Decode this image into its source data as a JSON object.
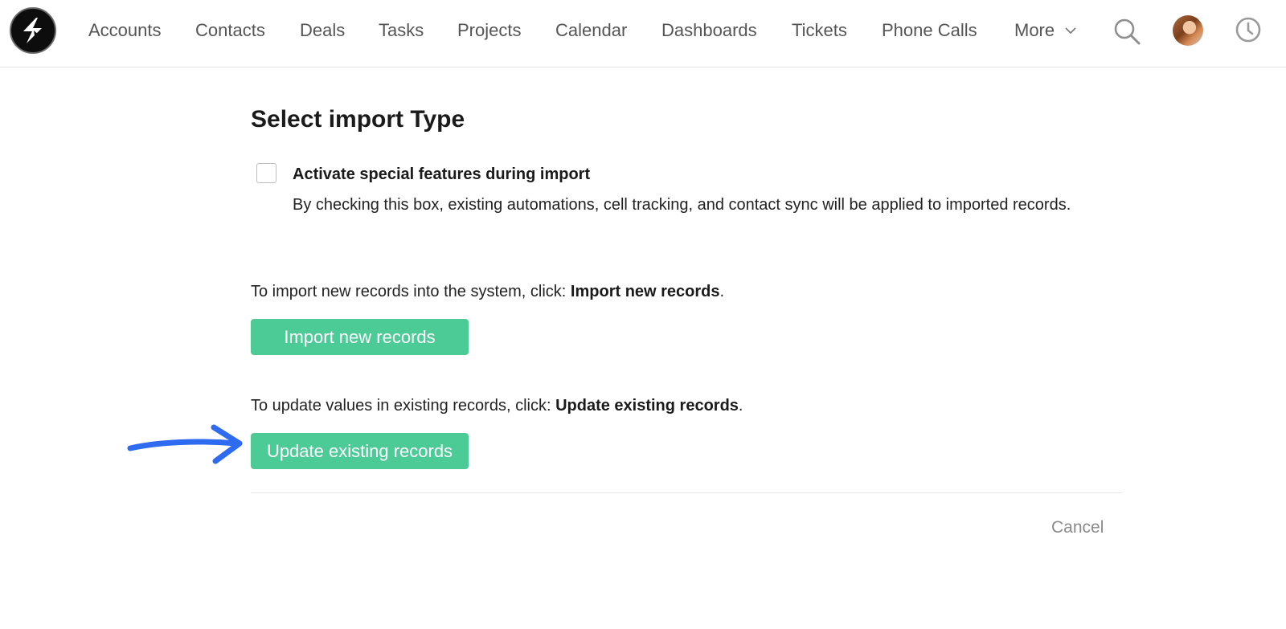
{
  "nav": {
    "items": [
      {
        "label": "Accounts"
      },
      {
        "label": "Contacts"
      },
      {
        "label": "Deals"
      },
      {
        "label": "Tasks"
      },
      {
        "label": "Projects"
      },
      {
        "label": "Calendar"
      },
      {
        "label": "Dashboards"
      },
      {
        "label": "Tickets"
      },
      {
        "label": "Phone Calls"
      }
    ],
    "more_label": "More",
    "logo_icon": "lightning-logo-icon",
    "search_icon": "search-icon",
    "avatar": "user-avatar",
    "history_icon": "clock-icon"
  },
  "main": {
    "title": "Select import Type",
    "special_features": {
      "label": "Activate special features during import",
      "description": "By checking this box, existing automations, cell tracking, and contact sync will be applied to imported records.",
      "checked": false
    },
    "import_new": {
      "instruction_prefix": "To import new records into the system, click: ",
      "instruction_bold": "Import new records",
      "instruction_suffix": ".",
      "button_label": "Import new records"
    },
    "update_existing": {
      "instruction_prefix": "To update values in existing records, click: ",
      "instruction_bold": "Update existing records",
      "instruction_suffix": ".",
      "button_label": "Update existing records"
    },
    "cancel_label": "Cancel"
  },
  "colors": {
    "button_green": "#4ccb96",
    "annotation_arrow": "#2f6bf0"
  }
}
